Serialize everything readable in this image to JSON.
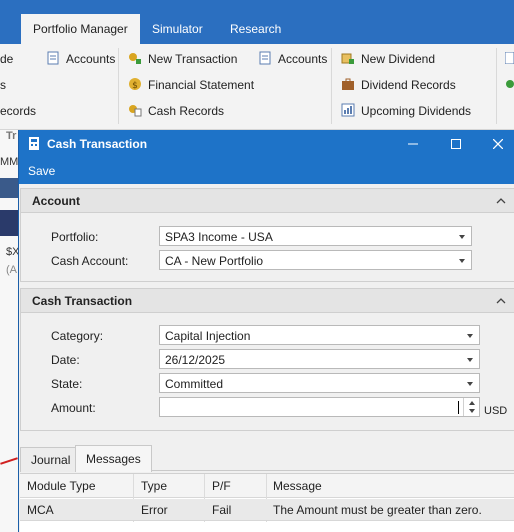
{
  "app": {
    "tabs": [
      "Portfolio Manager",
      "Simulator",
      "Research"
    ],
    "active_tab": "Portfolio Manager"
  },
  "ribbon": {
    "fragments": [
      "de",
      "s",
      "ecords"
    ],
    "col1": [
      "Accounts"
    ],
    "col2": [
      "New Transaction",
      "Financial Statement",
      "Cash Records"
    ],
    "col3": [
      "Accounts"
    ],
    "col4": [
      "New Dividend",
      "Dividend Records",
      "Upcoming Dividends"
    ]
  },
  "background": {
    "frag_tr": "Tr",
    "frag_mm": "MM",
    "frag_x": "$X",
    "frag_a": "(A"
  },
  "dialog": {
    "title": "Cash Transaction",
    "save_label": "Save",
    "account_section": {
      "title": "Account",
      "portfolio_label": "Portfolio:",
      "portfolio_value": "SPA3 Income - USA",
      "cash_account_label": "Cash Account:",
      "cash_account_value": "CA - New Portfolio"
    },
    "cash_section": {
      "title": "Cash Transaction",
      "category_label": "Category:",
      "category_value": "Capital Injection",
      "date_label": "Date:",
      "date_value": "26/12/2025",
      "state_label": "State:",
      "state_value": "Committed",
      "amount_label": "Amount:",
      "amount_value": "",
      "amount_unit": "USD"
    },
    "tabs": [
      "Journal",
      "Messages"
    ],
    "active_tab": "Messages",
    "grid": {
      "columns": [
        "Module Type",
        "Type",
        "P/F",
        "Message"
      ],
      "rows": [
        [
          "MCA",
          "Error",
          "Fail",
          "The Amount must be greater than zero."
        ]
      ]
    }
  }
}
